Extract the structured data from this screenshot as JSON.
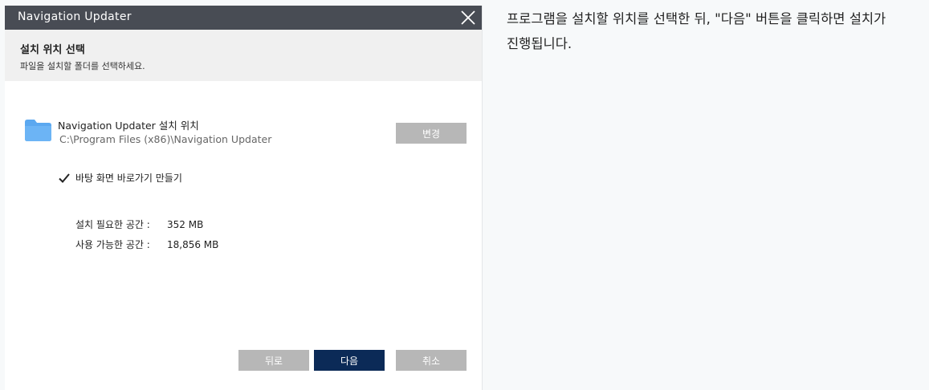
{
  "window": {
    "title": "Navigation Updater",
    "header": {
      "title": "설치 위치 선택",
      "subtitle": "파일을 설치할 폴더를 선택하세요."
    },
    "install_location": {
      "label": "Navigation Updater 설치 위치",
      "path": "C:\\Program Files (x86)\\Navigation Updater",
      "change_button": "변경"
    },
    "shortcut_checkbox": {
      "label": "바탕 화면 바로가기 만들기",
      "checked": true
    },
    "space": {
      "required_label": "설치 필요한 공간 :",
      "required_value": "352 MB",
      "available_label": "사용 가능한 공간 :",
      "available_value": "18,856 MB"
    },
    "buttons": {
      "back": "뒤로",
      "next": "다음",
      "cancel": "취소"
    }
  },
  "description": {
    "line1": "프로그램을 설치할 위치를 선택한 뒤, \"다음\" 버튼을 클릭하면 설치가",
    "line2": "진행됩니다."
  },
  "colors": {
    "titlebar": "#484c54",
    "header_band": "#f0f0f0",
    "folder": "#5ba8f0",
    "primary_button": "#0b2a57",
    "secondary_button": "#b7b7b7"
  },
  "icons": [
    "close-icon",
    "folder-icon",
    "checkmark-icon"
  ]
}
